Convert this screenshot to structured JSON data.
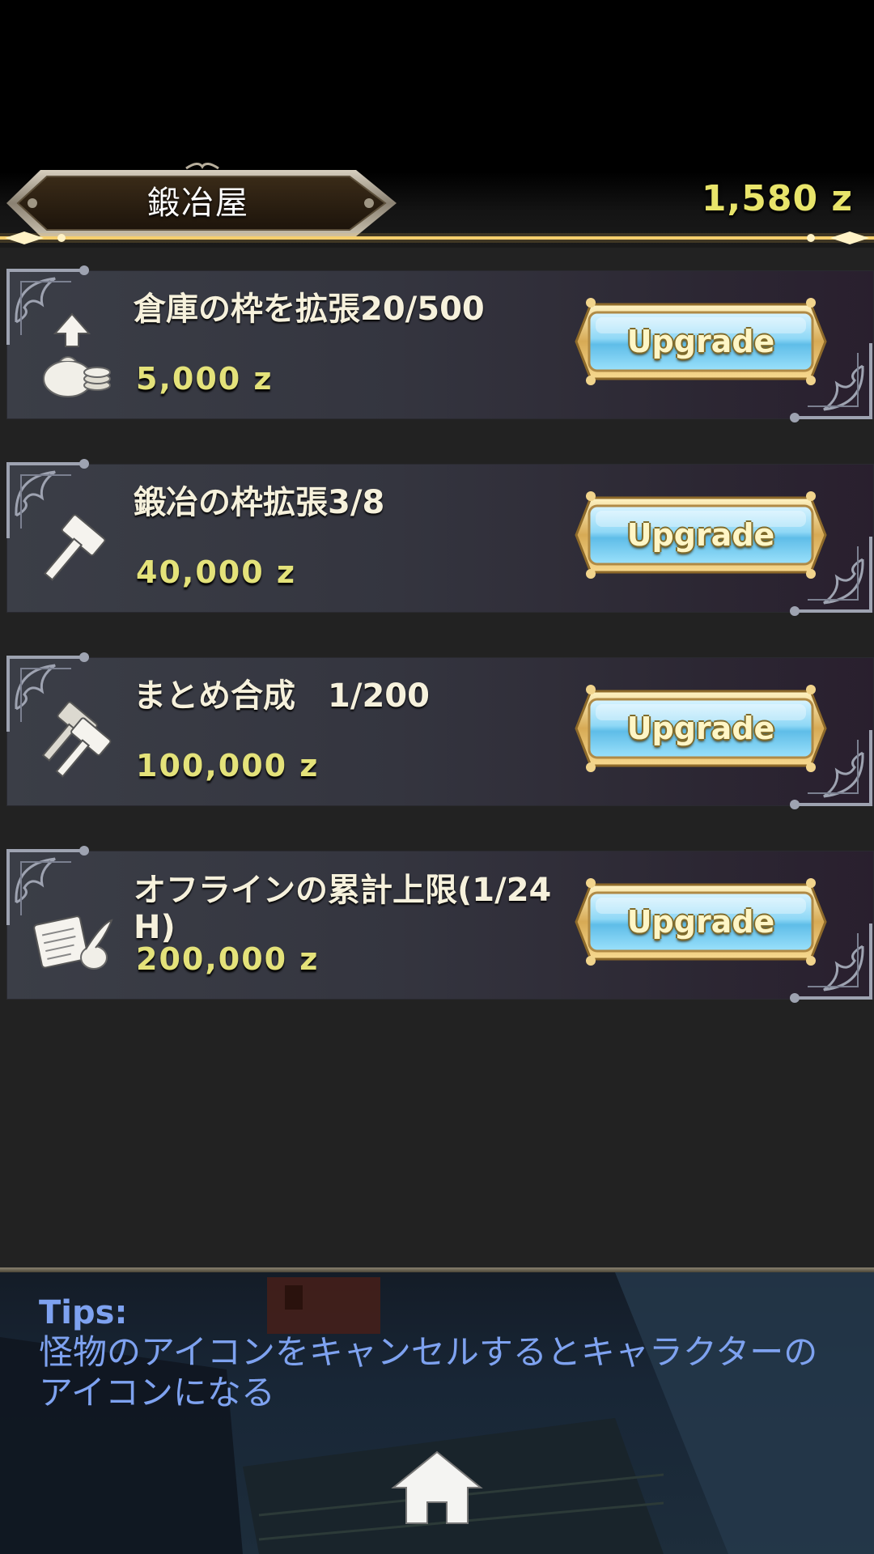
{
  "header": {
    "title": "鍛冶屋",
    "currency": "1,580 z"
  },
  "colors": {
    "gold_accent": "#f2c45a",
    "price_yellow": "#e4e27a",
    "button_blue": "#7fd3f4",
    "tips_blue": "#7ea2f0"
  },
  "upgrades": [
    {
      "icon": "money-bag-upload-icon",
      "title": "倉庫の枠を拡張20/500",
      "price": "5,000 z",
      "button": "Upgrade"
    },
    {
      "icon": "hammer-icon",
      "title": "鍛冶の枠拡張3/8",
      "price": "40,000 z",
      "button": "Upgrade"
    },
    {
      "icon": "double-hammer-icon",
      "title": "まとめ合成　1/200",
      "price": "100,000 z",
      "button": "Upgrade"
    },
    {
      "icon": "scroll-quill-icon",
      "title": "オフラインの累計上限(1/24 H)",
      "price": "200,000 z",
      "button": "Upgrade"
    }
  ],
  "tips": {
    "label": "Tips:",
    "text": "怪物のアイコンをキャンセルするとキャラクターのアイコンになる"
  },
  "nav": {
    "home_icon": "home-icon"
  }
}
